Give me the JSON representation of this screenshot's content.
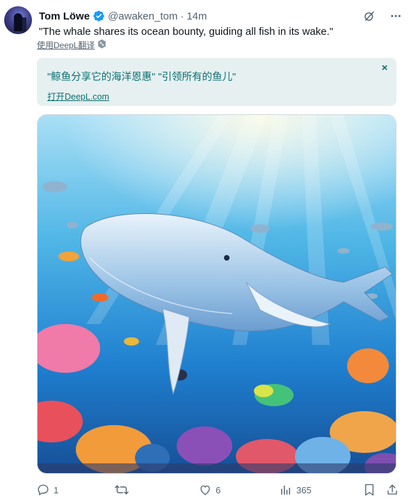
{
  "tweet": {
    "author_name": "Tom Löwe",
    "handle": "@awaken_tom",
    "separator": "·",
    "time": "14m",
    "text": "\"The whale shares its ocean bounty, guiding all fish in its wake.\"",
    "translate_label": "使用DeepL翻译"
  },
  "translation": {
    "text": "\"鲸鱼分享它的海洋恩惠\" \"引领所有的鱼儿\"",
    "link_label": "打开DeepL.com",
    "close_label": "×"
  },
  "media": {
    "description": "image-whale-underwater"
  },
  "actions": {
    "replies": "1",
    "reposts": "",
    "likes": "6",
    "views": "365"
  },
  "colors": {
    "accent": "#1d9bf0",
    "translation_bg": "#e6f0f0",
    "translation_text": "#0b6e73",
    "secondary_text": "#536471"
  },
  "icons": {
    "verified": "verified-badge-icon",
    "grok": "grok-icon",
    "more": "more-icon",
    "reply": "reply-icon",
    "repost": "repost-icon",
    "like": "like-icon",
    "views": "views-icon",
    "bookmark": "bookmark-icon",
    "share": "share-icon",
    "deepl": "deepl-icon"
  }
}
